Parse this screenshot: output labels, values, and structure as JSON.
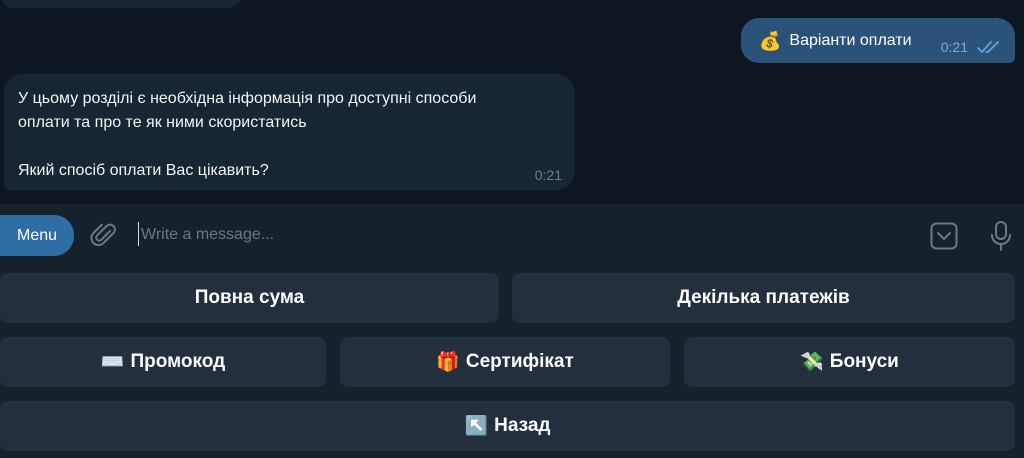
{
  "messages": {
    "outgoing": {
      "emoji": "💰",
      "text": "Варіанти оплати",
      "time": "0:21"
    },
    "incoming": {
      "line1": "У цьому розділі є необхідна інформація про доступні способи",
      "line2": "оплати та про те як ними скористатись",
      "line3": "Який спосіб оплати Вас цікавить?",
      "time": "0:21"
    }
  },
  "composer": {
    "menu_label": "Menu",
    "placeholder": "Write a message...",
    "icons": [
      "paperclip-icon",
      "keyboard-toggle-icon",
      "microphone-icon"
    ]
  },
  "keyboard": {
    "full_amount": "Повна сума",
    "installments": "Декілька платежів",
    "promocode_emoji": "⌨️",
    "promocode": "Промокод",
    "certificate_emoji": "🎁",
    "certificate": "Сертифікат",
    "bonuses_emoji": "💸",
    "bonuses": "Бонуси",
    "back_emoji": "↖️",
    "back": "Назад"
  },
  "colors": {
    "background": "#0e1621",
    "incoming_bubble": "#182533",
    "outgoing_bubble": "#2b5278",
    "panel": "#17212b",
    "keyboard_button": "#242f3d",
    "menu_button": "#2f6ea5",
    "read_ticks": "#5ea3e6"
  }
}
